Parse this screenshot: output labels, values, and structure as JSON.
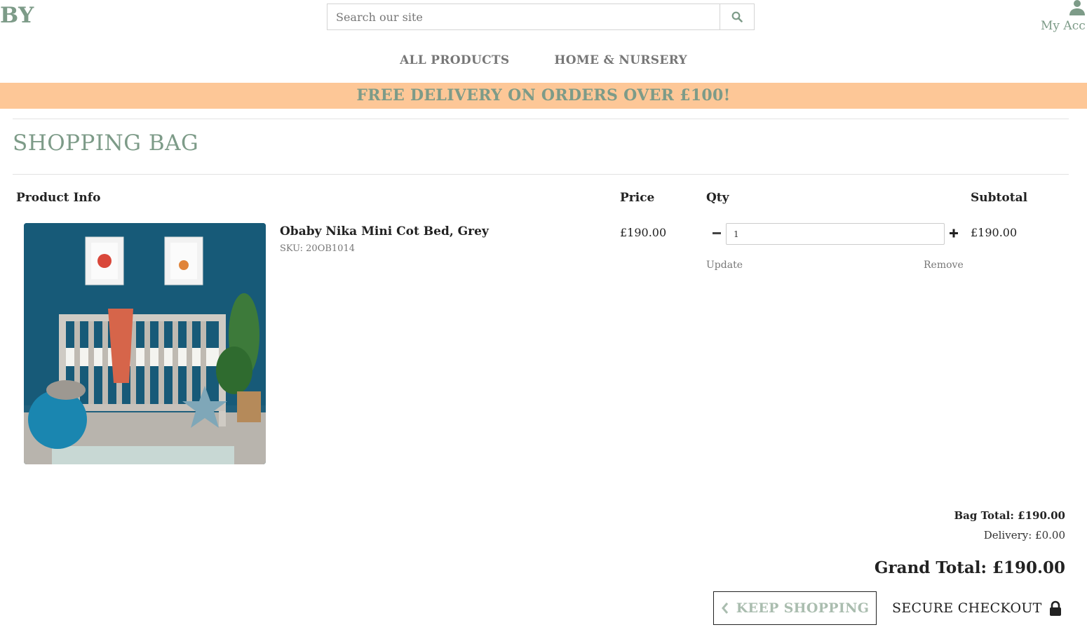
{
  "header": {
    "logo_text": "BY",
    "search": {
      "placeholder": "Search our site",
      "value": ""
    },
    "account_label": "My Acc"
  },
  "nav": {
    "items": [
      {
        "label": "ALL PRODUCTS"
      },
      {
        "label": "HOME & NURSERY"
      }
    ]
  },
  "banner": {
    "text": "FREE DELIVERY ON ORDERS OVER £100!"
  },
  "page": {
    "title": "SHOPPING BAG"
  },
  "table": {
    "headers": {
      "product_info": "Product Info",
      "price": "Price",
      "qty": "Qty",
      "subtotal": "Subtotal"
    },
    "rows": [
      {
        "name": "Obaby Nika Mini Cot Bed, Grey",
        "sku": "SKU: 20OB1014",
        "price": "£190.00",
        "qty": "1",
        "update_label": "Update",
        "remove_label": "Remove",
        "subtotal": "£190.00"
      }
    ]
  },
  "totals": {
    "bag_total": "Bag Total: £190.00",
    "delivery": "Delivery: £0.00",
    "grand_total": "Grand Total: £190.00"
  },
  "actions": {
    "keep_shopping": "KEEP SHOPPING",
    "secure_checkout": "SECURE CHECKOUT"
  },
  "colors": {
    "brand": "#7d9b88",
    "banner_bg": "#fdc797"
  }
}
